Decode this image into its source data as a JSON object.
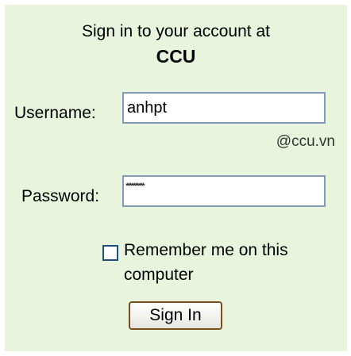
{
  "header": {
    "line1": "Sign in to your account at",
    "org": "CCU"
  },
  "form": {
    "username_label": "Username:",
    "username_value": "anhpt",
    "domain_suffix": "@ccu.vn",
    "password_label": "Password:",
    "password_mask": "**********",
    "remember_label": "Remember me on this computer",
    "remember_checked": false,
    "signin_label": "Sign In"
  },
  "colors": {
    "panel_bg": "#e8f5dc",
    "field_border": "#7f9db9",
    "button_border": "#7a4f1e"
  }
}
